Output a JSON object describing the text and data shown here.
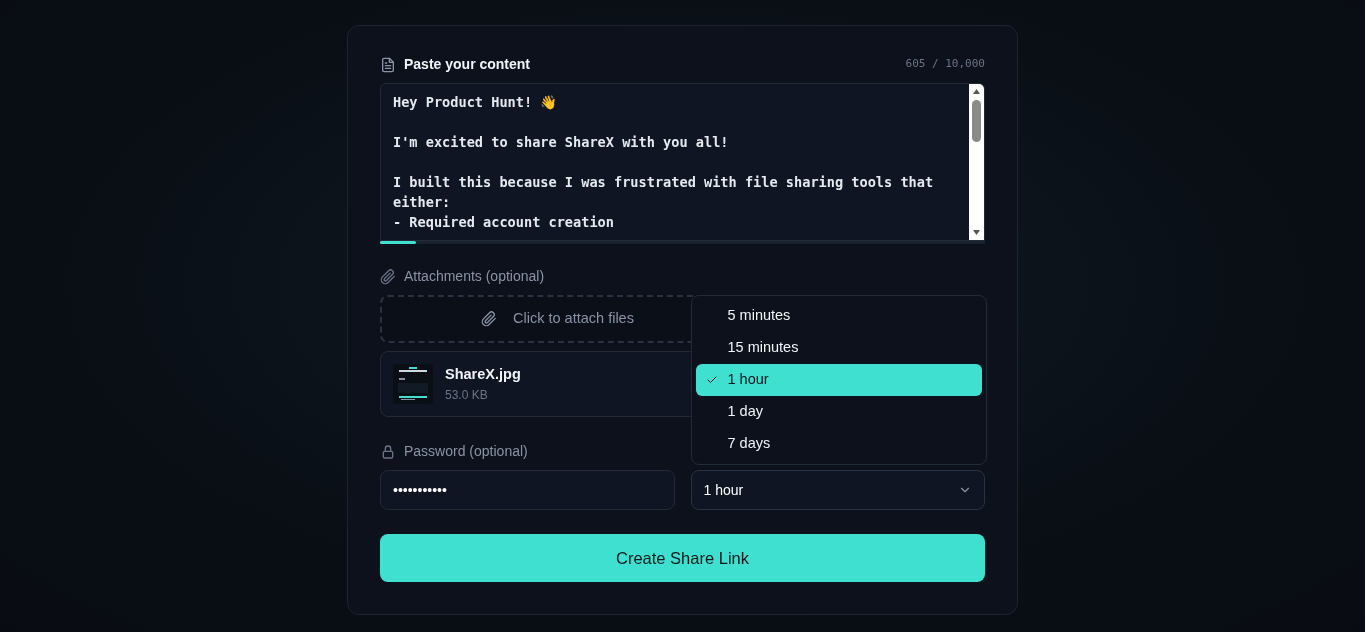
{
  "content": {
    "label": "Paste your content",
    "counter": "605 / 10,000",
    "paragraphs": [
      [
        "Hey Product Hunt! 👋"
      ],
      [
        "I'm excited to share ShareX with you all!"
      ],
      [
        "I built this because I was frustrated with file sharing tools that either:",
        "- Required account creation"
      ]
    ],
    "level": 0.06
  },
  "attachments": {
    "label": "Attachments (optional)",
    "dropzone": "Click to attach files",
    "files": [
      {
        "name": "ShareX.jpg",
        "size": "53.0 KB",
        "kind": "picture"
      }
    ]
  },
  "password": {
    "label": "Password (optional)",
    "value": "•••••••••••"
  },
  "expiry": {
    "value": "1 hour",
    "expanded": true,
    "options": [
      {
        "label": "5 minutes",
        "selected": false
      },
      {
        "label": "15 minutes",
        "selected": false
      },
      {
        "label": "1 hour",
        "selected": true
      },
      {
        "label": "1 day",
        "selected": false
      },
      {
        "label": "7 days",
        "selected": false
      }
    ]
  },
  "submit": "Create Share Link"
}
